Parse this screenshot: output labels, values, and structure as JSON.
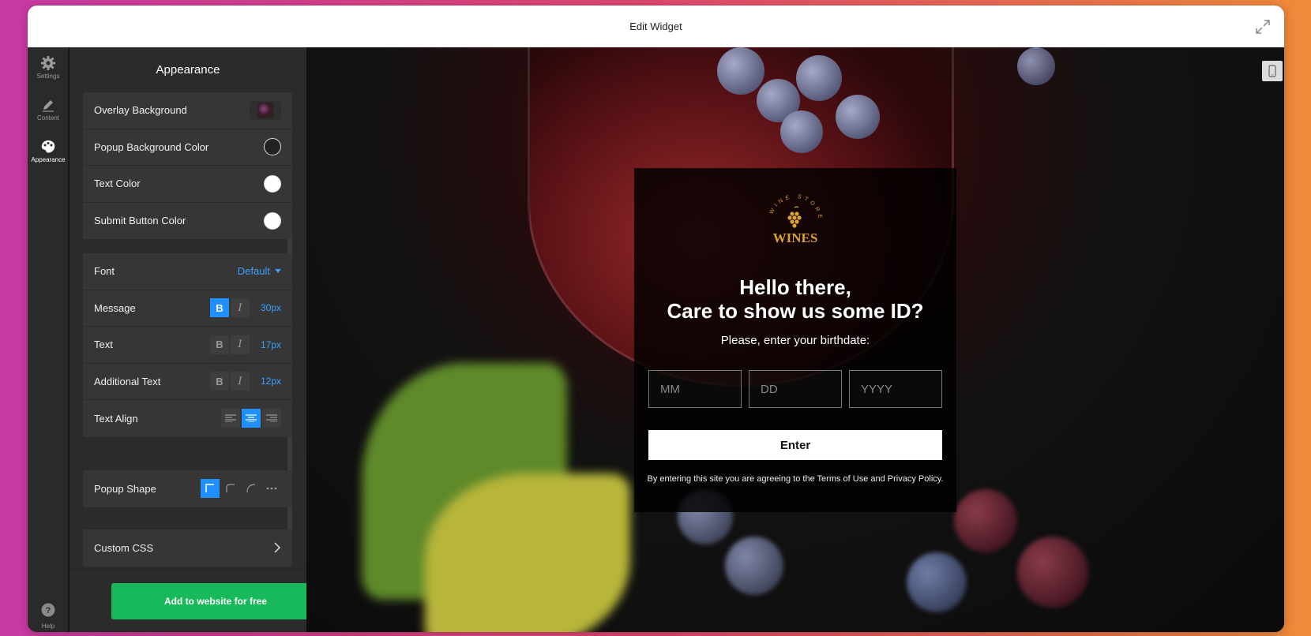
{
  "window": {
    "title": "Edit Widget"
  },
  "rail": {
    "items": [
      {
        "label": "Settings",
        "icon": "gear-icon"
      },
      {
        "label": "Content",
        "icon": "pencil-icon"
      },
      {
        "label": "Appearance",
        "icon": "palette-icon",
        "active": true
      }
    ],
    "help_label": "Help"
  },
  "panel": {
    "title": "Appearance",
    "colors": {
      "overlay_background": "Overlay Background",
      "popup_background_color": "Popup Background Color",
      "text_color": "Text Color",
      "submit_button_color": "Submit Button Color"
    },
    "typography": {
      "font_label": "Font",
      "font_value": "Default",
      "message_label": "Message",
      "message_size": "30px",
      "text_label": "Text",
      "text_size": "17px",
      "additional_label": "Additional Text",
      "additional_size": "12px",
      "align_label": "Text Align",
      "bold_glyph": "B",
      "italic_glyph": "I"
    },
    "shape": {
      "label": "Popup Shape"
    },
    "custom_css": {
      "label": "Custom CSS"
    },
    "cta_label": "Add to website for free"
  },
  "popup": {
    "logo_text": "WINES",
    "logo_arc_text": "WINE STORE",
    "message_line1": "Hello there,",
    "message_line2": "Care to show us some ID?",
    "subtitle": "Please, enter your birthdate:",
    "placeholders": {
      "month": "MM",
      "day": "DD",
      "year": "YYYY"
    },
    "enter_label": "Enter",
    "terms": "By entering this site you are agreeing to the Terms of Use and Privacy Policy."
  },
  "colors": {
    "accent": "#1e90ff",
    "cta": "#18b95a",
    "logo_gold": "#d9a233"
  }
}
